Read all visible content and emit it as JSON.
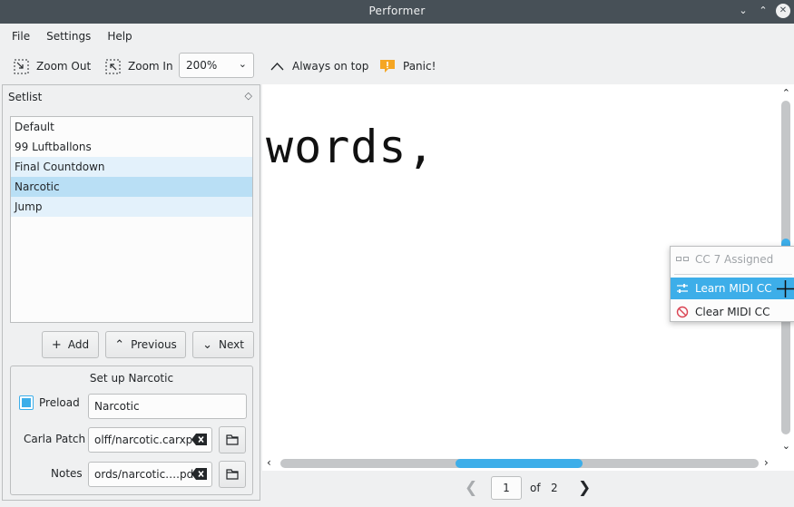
{
  "window": {
    "title": "Performer"
  },
  "menu": {
    "file": "File",
    "settings": "Settings",
    "help": "Help"
  },
  "toolbar": {
    "zoom_out": "Zoom Out",
    "zoom_in": "Zoom In",
    "zoom_level": "200%",
    "always_on_top": "Always on top",
    "panic": "Panic!"
  },
  "setlist": {
    "title": "Setlist",
    "items": [
      {
        "label": "Default"
      },
      {
        "label": "99 Luftballons"
      },
      {
        "label": "Final Countdown"
      },
      {
        "label": "Narcotic"
      },
      {
        "label": "Jump"
      }
    ],
    "selected": "Narcotic",
    "buttons": {
      "add": "Add",
      "previous": "Previous",
      "next": "Next"
    }
  },
  "setup": {
    "title": "Set up Narcotic",
    "preload_label": "Preload",
    "preload_checked": true,
    "name_value": "Narcotic",
    "carla_patch_label": "Carla Patch",
    "carla_patch_value": "olff/narcotic.carxp",
    "notes_label": "Notes",
    "notes_value": "ords/narcotic….pdf"
  },
  "viewer": {
    "document_text": "words,",
    "page_current": "1",
    "page_of": "of",
    "page_total": "2"
  },
  "context_menu": {
    "assigned": "CC 7 Assigned",
    "learn": "Learn MIDI CC",
    "clear": "Clear MIDI CC"
  },
  "colors": {
    "accent": "#3daee9",
    "titlebar": "#475057",
    "panic": "#f5a623"
  }
}
